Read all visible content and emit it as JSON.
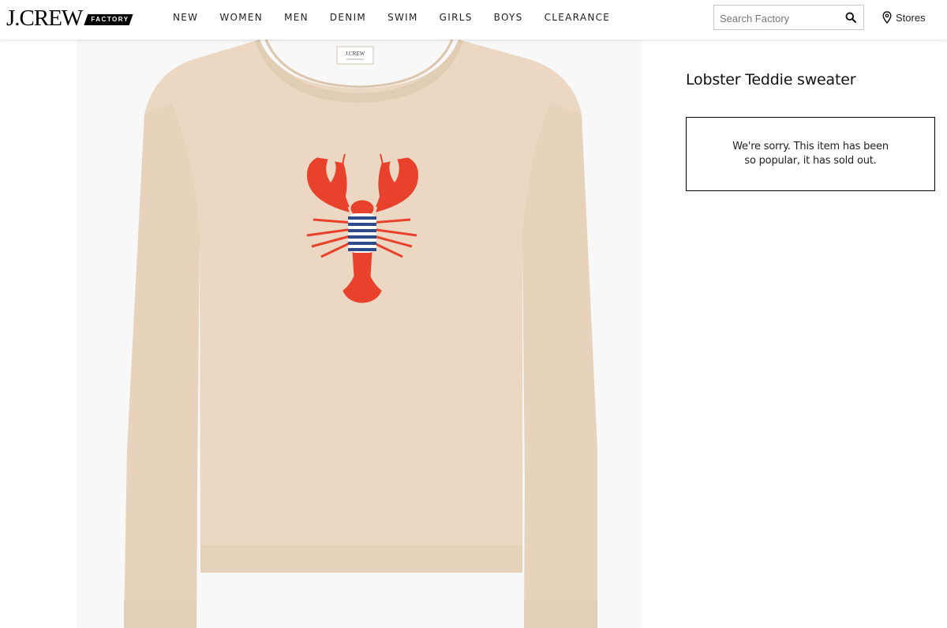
{
  "brand": {
    "name": "J.CREW",
    "sub": "FACTORY"
  },
  "nav": {
    "items": [
      "NEW",
      "WOMEN",
      "MEN",
      "DENIM",
      "SWIM",
      "GIRLS",
      "BOYS",
      "CLEARANCE"
    ]
  },
  "search": {
    "placeholder": "Search Factory",
    "icon": "search-icon"
  },
  "stores": {
    "label": "Stores",
    "icon": "map-pin-icon"
  },
  "product": {
    "title": "Lobster Teddie sweater",
    "sold_out_message": "We're sorry. This item has been so popular, it has sold out.",
    "image_label": "J.CREW"
  },
  "colors": {
    "sweater": "#ecd8c3",
    "lobster": "#e8422c",
    "stripes": "#2d4a8a"
  }
}
